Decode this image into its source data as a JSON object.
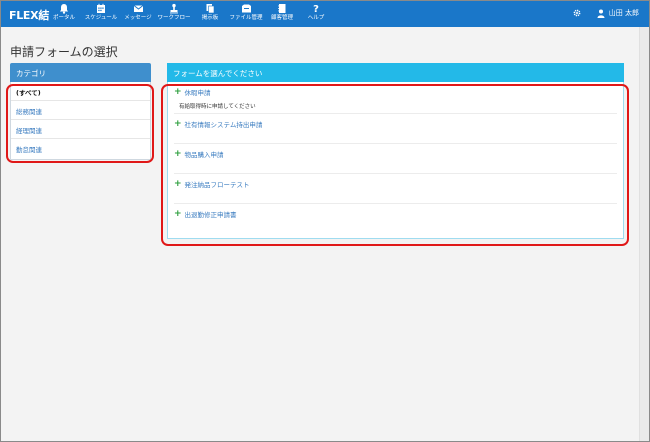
{
  "app": {
    "logo": "FLEX結"
  },
  "nav": [
    {
      "label": "ポータル",
      "icon": "bell-icon"
    },
    {
      "label": "スケジュール",
      "icon": "calendar-icon"
    },
    {
      "label": "メッセージ",
      "icon": "mail-icon"
    },
    {
      "label": "ワークフロー",
      "icon": "workflow-stamp-icon"
    },
    {
      "label": "掲示板",
      "icon": "board-icon"
    },
    {
      "label": "ファイル管理",
      "icon": "folder-icon"
    },
    {
      "label": "顧客管理",
      "icon": "customer-book-icon"
    },
    {
      "label": "ヘルプ",
      "icon": "help-icon"
    }
  ],
  "user": {
    "name": "山田 太郎",
    "settings_icon": "gear-icon",
    "avatar_icon": "user-icon"
  },
  "page": {
    "title": "申請フォームの選択"
  },
  "category": {
    "header": "カテゴリ",
    "items": [
      {
        "label": "(すべて)",
        "active": true
      },
      {
        "label": "総務関連",
        "active": false
      },
      {
        "label": "経理関連",
        "active": false
      },
      {
        "label": "勤怠関連",
        "active": false
      }
    ]
  },
  "forms": {
    "header": "フォームを選んでください",
    "items": [
      {
        "label": "休暇申請",
        "description": "有給取得時に申請してください"
      },
      {
        "label": "社有情報システム持出申請",
        "description": ""
      },
      {
        "label": "物品購入申請",
        "description": ""
      },
      {
        "label": "発注納品フローテスト",
        "description": ""
      },
      {
        "label": "出退勤修正申請書",
        "description": ""
      }
    ]
  },
  "colors": {
    "topbar": "#1a77c9",
    "category_header": "#3f8fcd",
    "form_header": "#23b9e8",
    "link": "#3a7cc0",
    "plus": "#2a9d3a",
    "highlight": "#e01818"
  }
}
